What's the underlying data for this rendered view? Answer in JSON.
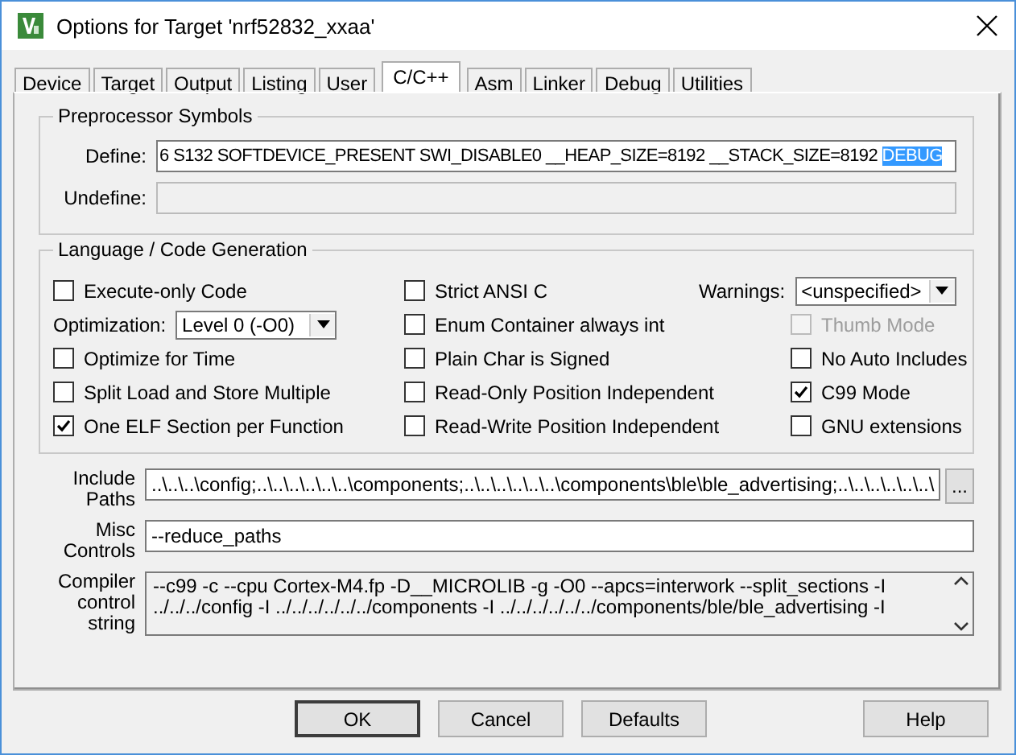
{
  "window": {
    "title": "Options for Target 'nrf52832_xxaa'"
  },
  "tabs": [
    {
      "label": "Device",
      "selected": false
    },
    {
      "label": "Target",
      "selected": false
    },
    {
      "label": "Output",
      "selected": false
    },
    {
      "label": "Listing",
      "selected": false
    },
    {
      "label": "User",
      "selected": false
    },
    {
      "label": "C/C++",
      "selected": true
    },
    {
      "label": "Asm",
      "selected": false
    },
    {
      "label": "Linker",
      "selected": false
    },
    {
      "label": "Debug",
      "selected": false
    },
    {
      "label": "Utilities",
      "selected": false
    }
  ],
  "preprocessor": {
    "title": "Preprocessor Symbols",
    "define": {
      "label": "Define:",
      "value": "6 S132 SOFTDEVICE_PRESENT SWI_DISABLE0 __HEAP_SIZE=8192 __STACK_SIZE=8192 ",
      "selected_text": "DEBUG"
    },
    "undefine": {
      "label": "Undefine:",
      "disabled": true
    }
  },
  "language": {
    "title": "Language / Code Generation",
    "columns": [
      [
        {
          "kind": "checkbox",
          "label": "Execute-only Code",
          "checked": false,
          "disabled": false
        },
        {
          "kind": "dropdown",
          "label": "Optimization:",
          "value": "Level 0 (-O0)"
        },
        {
          "kind": "checkbox",
          "label": "Optimize for Time",
          "checked": false,
          "disabled": false
        },
        {
          "kind": "checkbox",
          "label": "Split Load and Store Multiple",
          "checked": false,
          "disabled": false
        },
        {
          "kind": "checkbox",
          "label": "One ELF Section per Function",
          "checked": true,
          "disabled": false
        }
      ],
      [
        {
          "kind": "checkbox",
          "label": "Strict ANSI C",
          "checked": false,
          "disabled": false
        },
        {
          "kind": "checkbox",
          "label": "Enum Container always int",
          "checked": false,
          "disabled": false
        },
        {
          "kind": "checkbox",
          "label": "Plain Char is Signed",
          "checked": false,
          "disabled": false
        },
        {
          "kind": "checkbox",
          "label": "Read-Only Position Independent",
          "checked": false,
          "disabled": false
        },
        {
          "kind": "checkbox",
          "label": "Read-Write Position Independent",
          "checked": false,
          "disabled": false
        }
      ],
      [
        {
          "kind": "dropdown",
          "label": "Warnings:",
          "value": "<unspecified>"
        },
        {
          "kind": "checkbox",
          "label": "Thumb Mode",
          "checked": false,
          "disabled": true
        },
        {
          "kind": "checkbox",
          "label": "No Auto Includes",
          "checked": false,
          "disabled": false
        },
        {
          "kind": "checkbox",
          "label": "C99 Mode",
          "checked": true,
          "disabled": false
        },
        {
          "kind": "checkbox",
          "label": "GNU extensions",
          "checked": false,
          "disabled": false
        }
      ]
    ]
  },
  "include_paths": {
    "label": "Include Paths",
    "value": "..\\..\\..\\config;..\\..\\..\\..\\..\\..\\components;..\\..\\..\\..\\..\\..\\components\\ble\\ble_advertising;..\\..\\..\\..\\..\\..\\",
    "browse_button": "..."
  },
  "misc_controls": {
    "label": "Misc Controls",
    "value": "--reduce_paths"
  },
  "compiler_control_string": {
    "label": "Compiler control string",
    "value": "--c99 -c --cpu Cortex-M4.fp -D__MICROLIB -g -O0 --apcs=interwork --split_sections -I ../../../config -I ../../../../../../components -I ../../../../../../components/ble/ble_advertising -I"
  },
  "buttons": [
    {
      "label": "OK",
      "default": true
    },
    {
      "label": "Cancel",
      "default": false
    },
    {
      "label": "Defaults",
      "default": false
    },
    {
      "label": "Help",
      "default": false
    }
  ]
}
